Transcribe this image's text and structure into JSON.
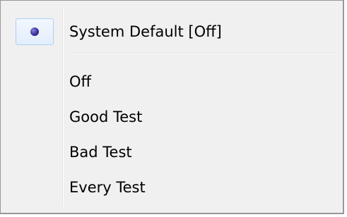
{
  "menu": {
    "default_item": {
      "label": "System Default [Off]",
      "selected": true,
      "indicator_icon": "radio-bullet-icon"
    },
    "options": [
      {
        "label": "Off"
      },
      {
        "label": "Good Test"
      },
      {
        "label": "Bad Test"
      },
      {
        "label": "Every Test"
      }
    ]
  }
}
